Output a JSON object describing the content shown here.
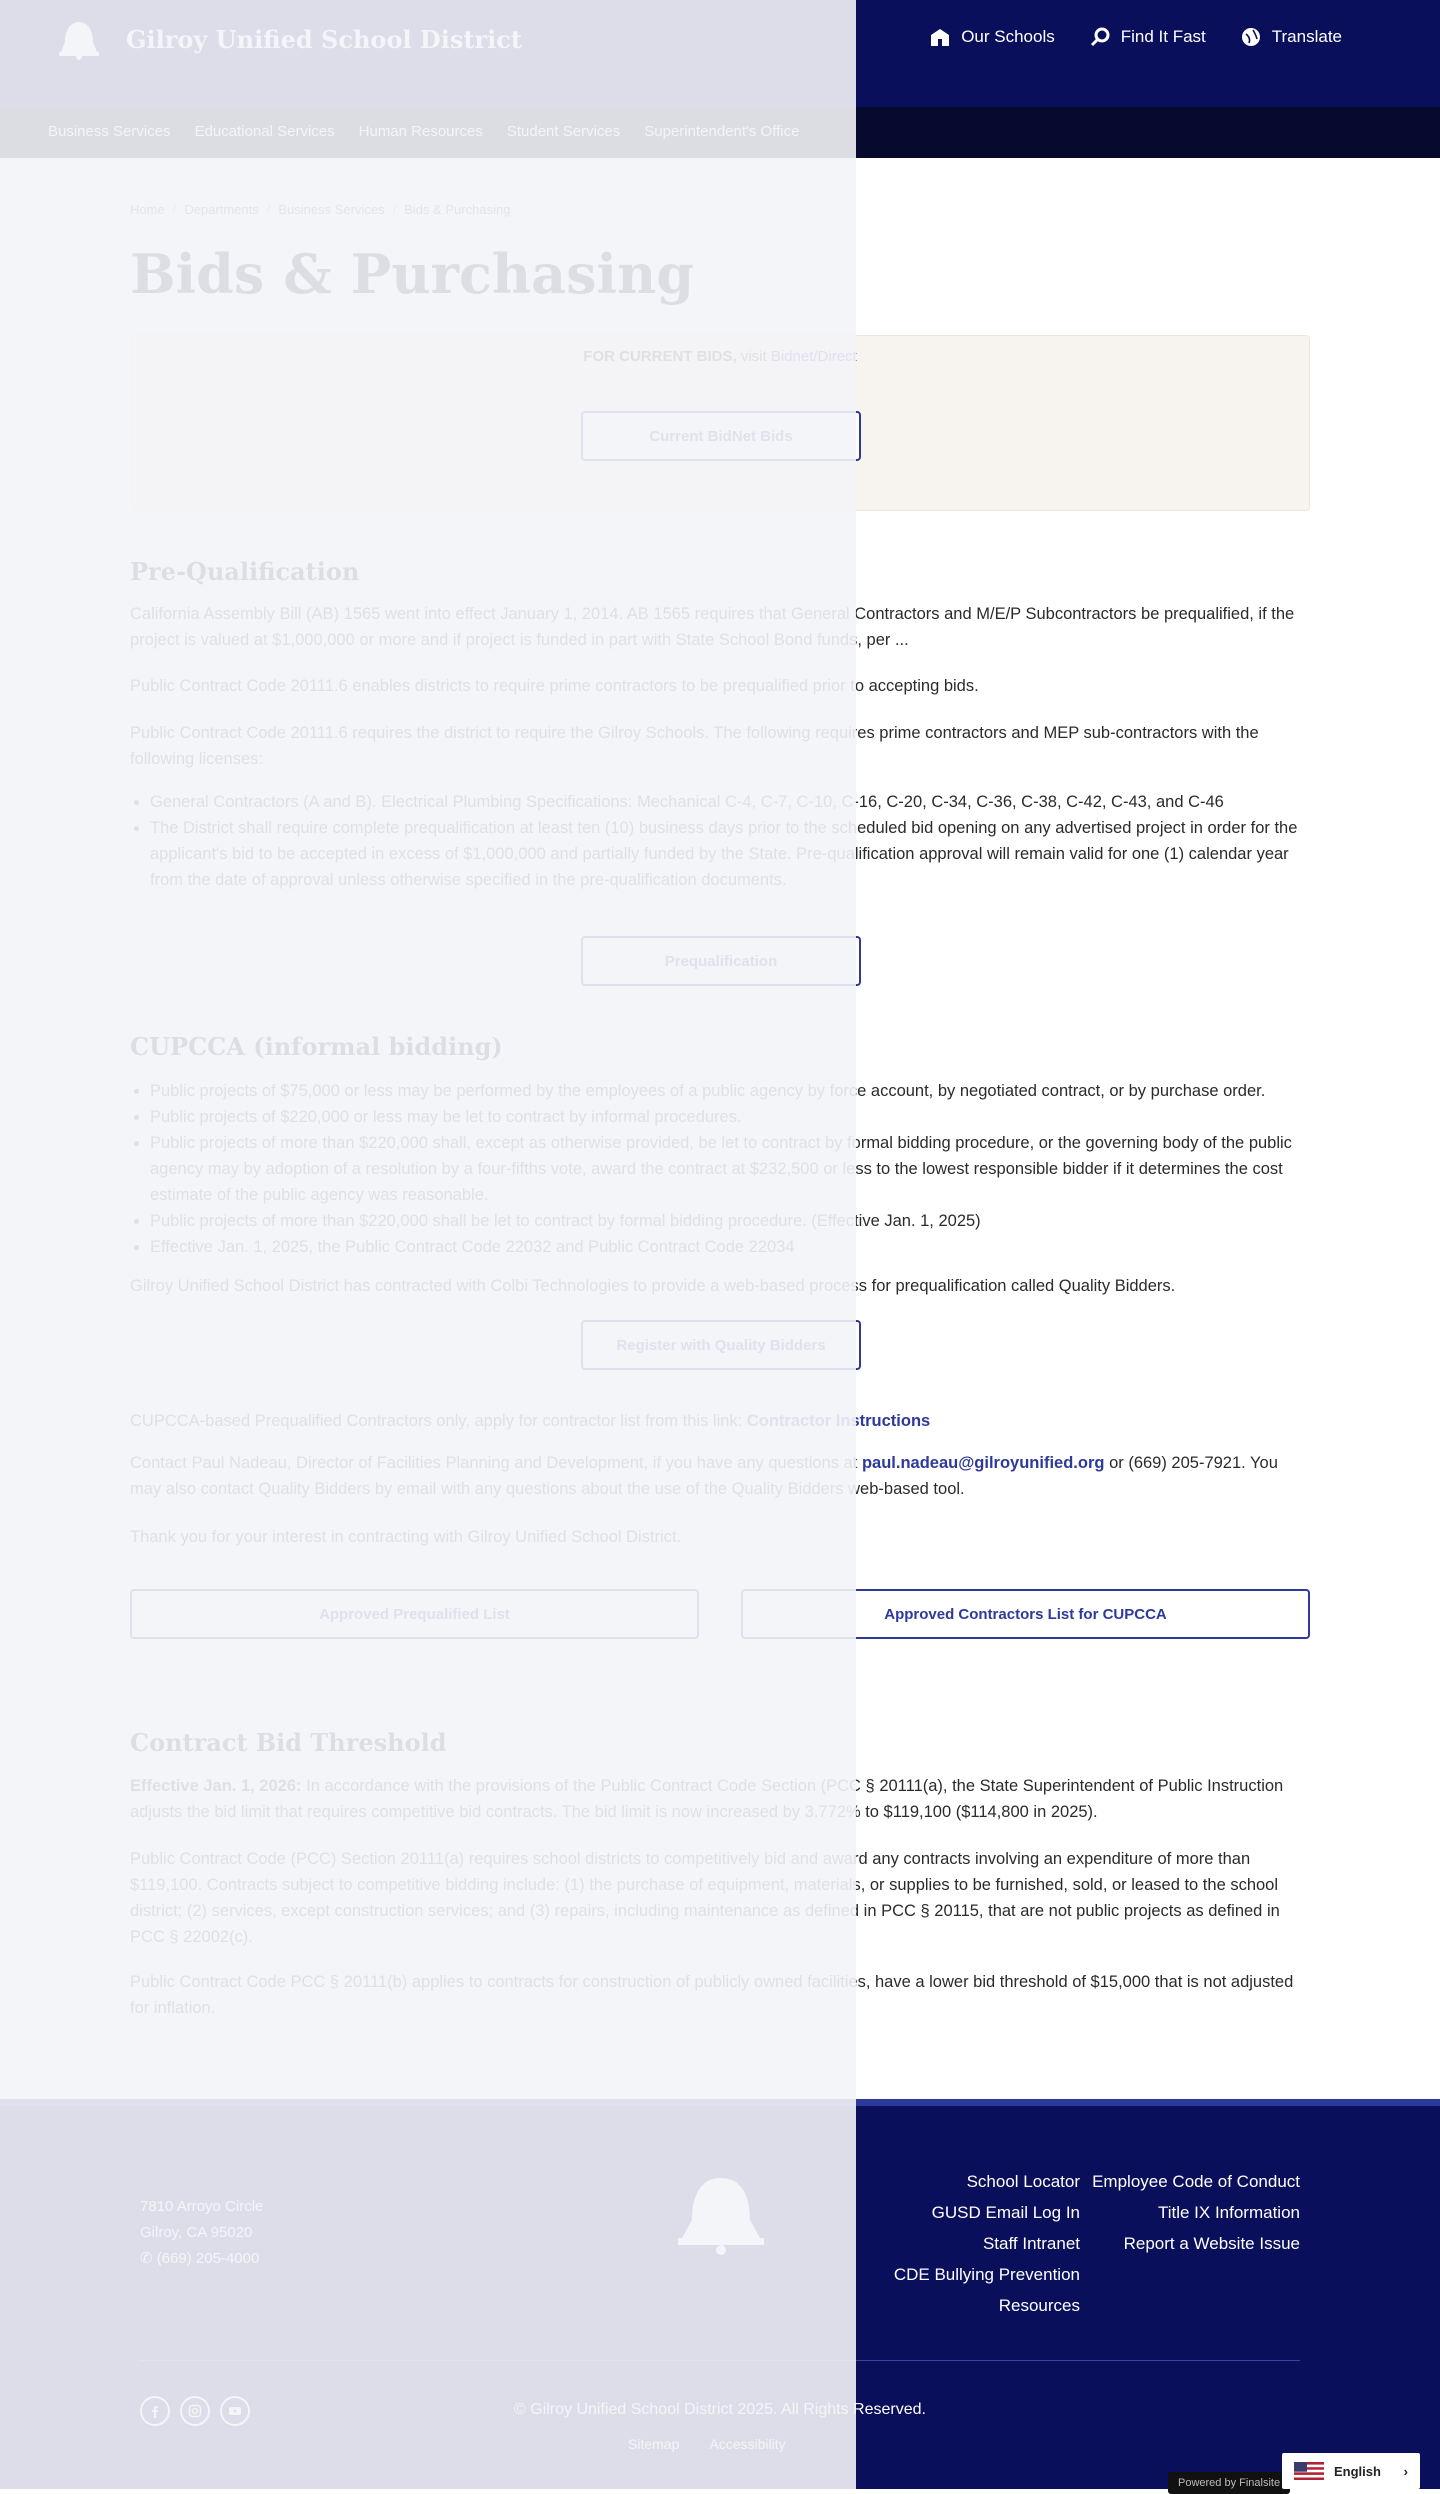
{
  "header": {
    "site_name": "Gilroy Unified School District",
    "util_nav": [
      {
        "label": "Our Schools",
        "icon": "school-icon"
      },
      {
        "label": "Find It Fast",
        "icon": "magnifier-icon"
      },
      {
        "label": "Translate",
        "icon": "globe-icon"
      }
    ],
    "main_nav": [
      "Business Services",
      "Educational Services",
      "Human Resources",
      "Student Services",
      "Superintendent's Office"
    ]
  },
  "breadcrumb": [
    "Home",
    "Departments",
    "Business Services",
    "Bids & Purchasing"
  ],
  "page_title": "Bids & Purchasing",
  "bids": {
    "prefix": "FOR CURRENT BIDS,",
    "visit": "visit",
    "link": "Bidnet/Direct",
    "button": "Current BidNet Bids"
  },
  "prequal": {
    "title": "Pre-Qualification",
    "p1": "California Assembly Bill (AB) 1565 went into effect January 1, 2014. AB 1565 requires that General Contractors and M/E/P Subcontractors be prequalified, if the project is valued at $1,000,000 or more and if project is funded in part with State School Bond funds, per ...",
    "p2": "Public Contract Code 20111.6 enables districts to require prime contractors to be prequalified prior to accepting bids.",
    "p3": "Public Contract Code 20111.6 requires the district to require the Gilroy Schools. The following requires prime contractors and MEP sub-contractors with the following licenses:",
    "bullets": [
      "General Contractors (A and B). Electrical Plumbing Specifications: Mechanical C-4, C-7, C-10, C-16, C-20, C-34, C-36, C-38, C-42, C-43, and C-46",
      "The District shall require complete prequalification at least ten (10) business days prior to the scheduled bid opening on any advertised project in order for the applicant's bid to be accepted in excess of $1,000,000 and partially funded by the State. Pre-qualification approval will remain valid for one (1) calendar year from the date of approval unless otherwise specified in the pre-qualification documents."
    ],
    "button": "Prequalification"
  },
  "cupcca": {
    "title": "CUPCCA (informal bidding)",
    "bullets": [
      "Public projects of $75,000 or less may be performed by the employees of a public agency by force account, by negotiated contract, or by purchase order.",
      "Public projects of $220,000 or less may be let to contract by informal procedures.",
      "Public projects of more than $220,000 shall, except as otherwise provided, be let to contract by formal bidding procedure, or the governing body of the public agency may by adoption of a resolution by a four-fifths vote, award the contract at $232,500 or less to the lowest responsible bidder if it determines the cost estimate of the public agency was reasonable.",
      "Public projects of more than $220,000 shall be let to contract by formal bidding procedure. (Effective Jan. 1, 2025)",
      "Effective Jan. 1, 2025, the Public Contract Code 22032 and Public Contract Code 22034"
    ],
    "p1": "Gilroy Unified School District has contracted with Colbi Technologies to provide a web-based process for prequalification called Quality Bidders.",
    "button": "Register with Quality Bidders",
    "p2_prefix": "CUPCCA-based Prequalified Contractors only, apply for contractor list from this link:",
    "p2_link": "Contractor Instructions",
    "p3_prefix": "Contact Paul Nadeau, Director of Facilities Planning and Development, if you have any questions at",
    "p3_email": "paul.nadeau@gilroyunified.org",
    "p3_suffix": "or (669) 205-7921.  You may also contact Quality Bidders by email with any questions about the use of the Quality Bidders web-based tool.",
    "p4": "Thank you for your interest in contracting with Gilroy Unified School District.",
    "btn_left": "Approved Prequalified List",
    "btn_right": "Approved Contractors List for CUPCCA"
  },
  "threshold": {
    "title": "Contract Bid Threshold",
    "p1_bold": "Effective Jan. 1, 2026:",
    "p1": "In accordance with the provisions of the Public Contract Code Section (PCC § 20111(a), the State Superintendent of Public Instruction adjusts the bid limit that requires competitive bid contracts. The bid limit is now increased by 3.772% to $119,100 ($114,800 in 2025).",
    "p2": "Public Contract Code (PCC) Section 20111(a) requires school districts to competitively bid and award any contracts involving an expenditure of more than $119,100. Contracts subject to competitive bidding include: (1) the purchase of equipment, materials, or supplies to be furnished, sold, or leased to the school district; (2) services, except construction services; and (3) repairs, including maintenance as defined in PCC § 20115, that are not public projects as defined in PCC § 22002(c).",
    "p3": "Public Contract Code PCC § 20111(b) applies to contracts for construction of publicly owned facilities, have a lower bid threshold of $15,000 that is not adjusted for inflation."
  },
  "footer": {
    "address": [
      "7810 Arroyo Circle",
      "Gilroy, CA 95020",
      "(669) 205-4000"
    ],
    "links_col1": [
      "School Locator",
      "GUSD Email Log In",
      "Staff Intranet",
      "CDE Bullying Prevention",
      "Resources"
    ],
    "links_col2": [
      "Employee Code of Conduct",
      "Title IX Information",
      "Report a Website Issue"
    ],
    "copyright": "© Gilroy Unified School District 2025. All Rights Reserved.",
    "bottom_links": [
      "Sitemap",
      "Accessibility"
    ],
    "powered": "Powered by Finalsite"
  },
  "language_button": "English"
}
